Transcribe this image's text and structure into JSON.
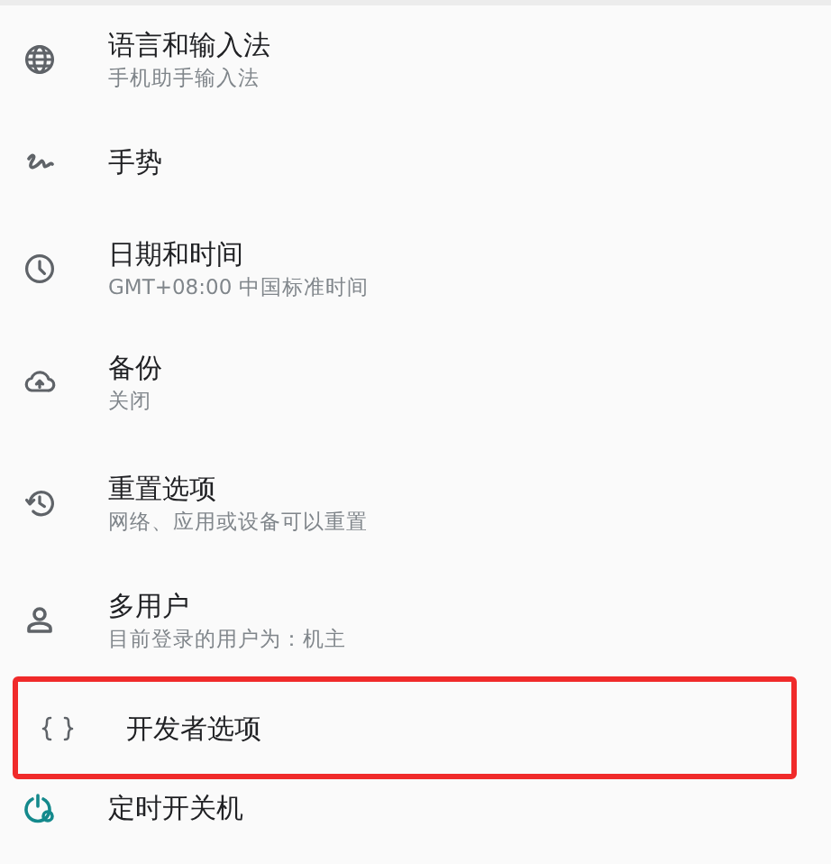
{
  "settings_items": [
    {
      "title": "语言和输入法",
      "subtitle": "手机助手输入法",
      "highlighted": false
    },
    {
      "title": "手势",
      "highlighted": false
    },
    {
      "title": "日期和时间",
      "subtitle": "GMT+08:00 中国标准时间",
      "highlighted": false
    },
    {
      "title": "备份",
      "subtitle": "关闭",
      "highlighted": false
    },
    {
      "title": "重置选项",
      "subtitle": "网络、应用或设备可以重置",
      "highlighted": false
    },
    {
      "title": "多用户",
      "subtitle": "目前登录的用户为：机主",
      "highlighted": false
    },
    {
      "title": "开发者选项",
      "highlighted": true
    },
    {
      "title": "定时开关机",
      "highlighted": false
    }
  ]
}
